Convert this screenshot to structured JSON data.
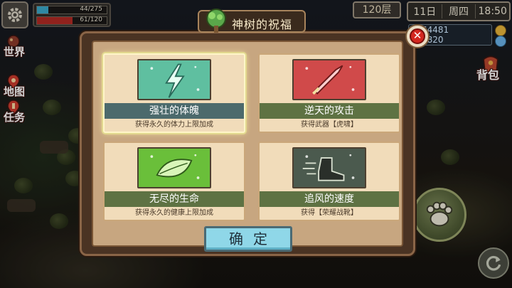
{
  "hud": {
    "exp_text": "44/275",
    "exp_fraction": 0.16,
    "hp_text": "61/120",
    "hp_fraction": 0.51,
    "floor": "120层",
    "date": "11日",
    "weekday": "周四",
    "time": "18:50",
    "currency_1": "64481",
    "currency_2": "3820"
  },
  "side_nav": {
    "world": "世界",
    "map": "地图",
    "quest": "任务",
    "bag": "背包"
  },
  "dialog": {
    "title": "神树的祝福",
    "confirm_label": "确定",
    "cards": [
      {
        "name": "强壮的体魄",
        "desc": "获得永久的体力上限加成",
        "selected": true,
        "color": "#5fbfa0"
      },
      {
        "name": "逆天的攻击",
        "desc": "获得武器【虎啸】",
        "selected": false,
        "color": "#d04a4a"
      },
      {
        "name": "无尽的生命",
        "desc": "获得永久的健康上限加成",
        "selected": false,
        "color": "#6abf3a"
      },
      {
        "name": "追风的速度",
        "desc": "获得【荣耀战靴】",
        "selected": false,
        "color": "#4b5a4e"
      }
    ]
  },
  "icons": [
    "gear-icon",
    "world-icon",
    "map-icon",
    "quest-icon",
    "bag-icon",
    "close-icon",
    "tree-icon",
    "paw-icon",
    "refresh-icon"
  ]
}
